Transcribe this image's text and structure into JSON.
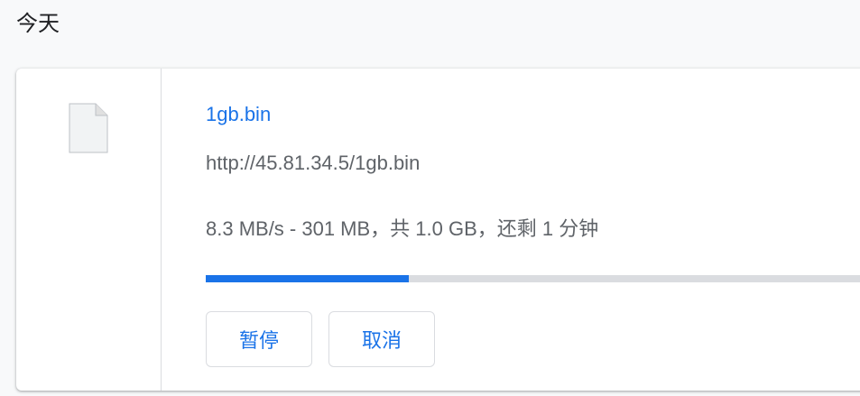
{
  "section": {
    "date_header": "今天"
  },
  "download": {
    "file_name": "1gb.bin",
    "url": "http://45.81.34.5/1gb.bin",
    "status": "8.3 MB/s - 301 MB，共 1.0 GB，还剩 1 分钟",
    "progress_fraction": 0.3,
    "icon": "file-icon",
    "buttons": {
      "pause_label": "暂停",
      "cancel_label": "取消"
    }
  },
  "colors": {
    "accent": "#1a73e8",
    "track": "#dadce0",
    "secondary_text": "#5f6368",
    "background": "#f8f9fa"
  }
}
